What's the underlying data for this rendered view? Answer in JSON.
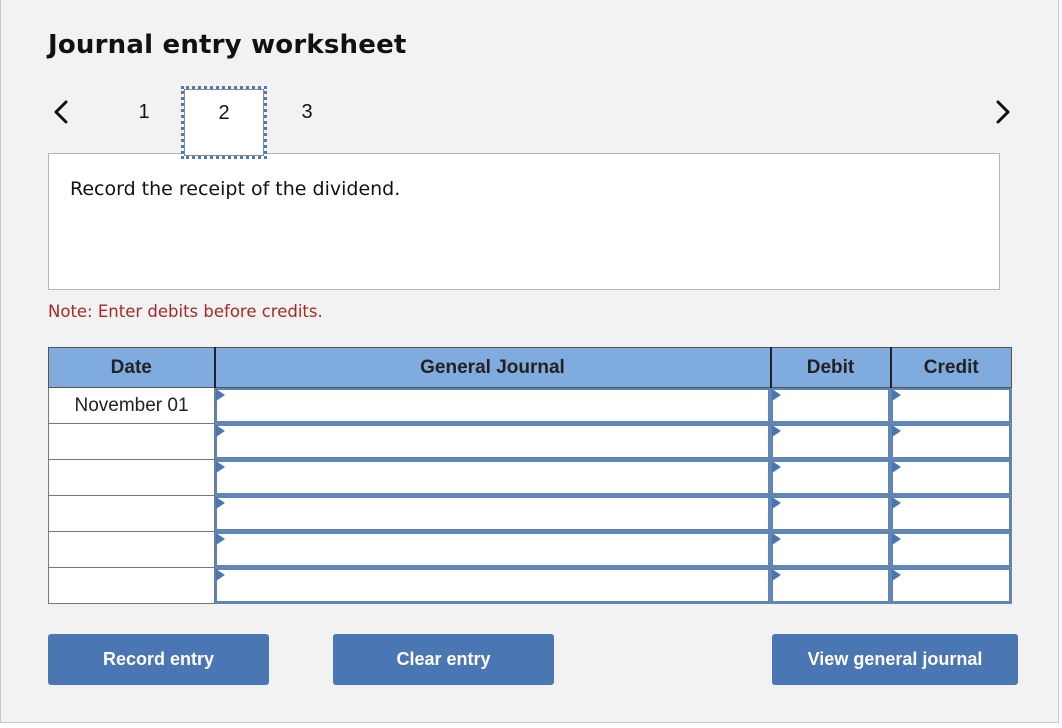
{
  "header": {
    "title": "Journal entry worksheet"
  },
  "navigation": {
    "prev_icon": "chevron-left-icon",
    "next_icon": "chevron-right-icon",
    "tabs": [
      {
        "label": "1",
        "active": false
      },
      {
        "label": "2",
        "active": true
      },
      {
        "label": "3",
        "active": false
      }
    ]
  },
  "instruction": {
    "text": "Record the receipt of the dividend."
  },
  "note": {
    "text": "Note: Enter debits before credits.",
    "color": "#a32a2a"
  },
  "journal_table": {
    "columns": [
      "Date",
      "General Journal",
      "Debit",
      "Credit"
    ],
    "rows": [
      {
        "date": "November 01",
        "account": "",
        "debit": "",
        "credit": ""
      },
      {
        "date": "",
        "account": "",
        "debit": "",
        "credit": ""
      },
      {
        "date": "",
        "account": "",
        "debit": "",
        "credit": ""
      },
      {
        "date": "",
        "account": "",
        "debit": "",
        "credit": ""
      },
      {
        "date": "",
        "account": "",
        "debit": "",
        "credit": ""
      },
      {
        "date": "",
        "account": "",
        "debit": "",
        "credit": ""
      }
    ],
    "header_color": "#80abdf"
  },
  "buttons": {
    "record_entry": "Record entry",
    "clear_entry": "Clear entry",
    "view_general_journal": "View general journal",
    "color": "#4a76b4"
  }
}
